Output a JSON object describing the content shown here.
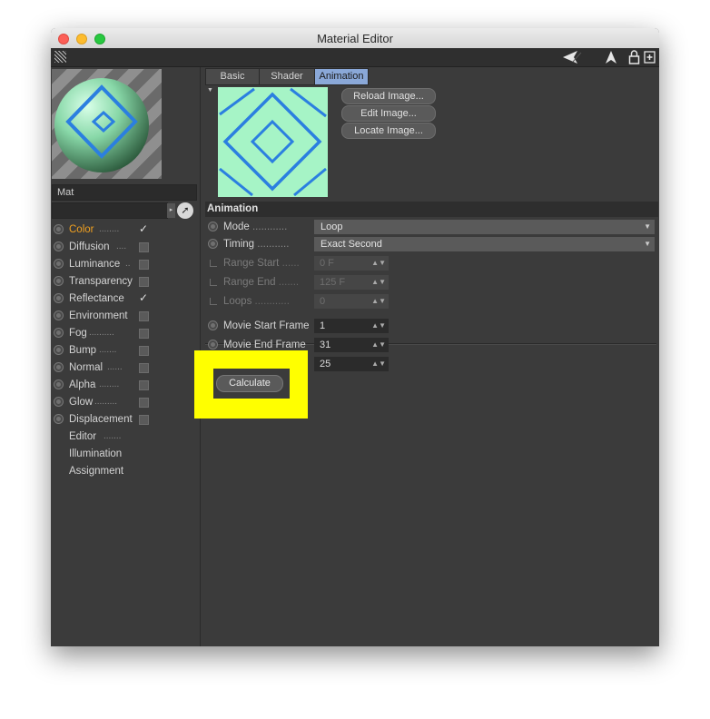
{
  "window": {
    "title": "Material Editor"
  },
  "material": {
    "name": "Mat"
  },
  "channels": [
    {
      "label": "Color",
      "dots": "........",
      "active": true,
      "checkbox": "checked"
    },
    {
      "label": "Diffusion",
      "dots": "....",
      "active": false,
      "checkbox": "unchecked"
    },
    {
      "label": "Luminance",
      "dots": "..",
      "active": false,
      "checkbox": "unchecked"
    },
    {
      "label": "Transparency",
      "dots": "",
      "active": false,
      "checkbox": "unchecked"
    },
    {
      "label": "Reflectance",
      "dots": "",
      "active": false,
      "checkbox": "checked"
    },
    {
      "label": "Environment",
      "dots": "",
      "active": false,
      "checkbox": "unchecked"
    },
    {
      "label": "Fog",
      "dots": "..........",
      "active": false,
      "checkbox": "unchecked"
    },
    {
      "label": "Bump",
      "dots": ".......",
      "active": false,
      "checkbox": "unchecked"
    },
    {
      "label": "Normal",
      "dots": "......",
      "active": false,
      "checkbox": "unchecked"
    },
    {
      "label": "Alpha",
      "dots": "........",
      "active": false,
      "checkbox": "unchecked"
    },
    {
      "label": "Glow",
      "dots": ".........",
      "active": false,
      "checkbox": "unchecked"
    },
    {
      "label": "Displacement",
      "dots": "",
      "active": false,
      "checkbox": "unchecked"
    }
  ],
  "extra_items": [
    {
      "label": "Editor",
      "dots": "......."
    },
    {
      "label": "Illumination",
      "dots": ""
    },
    {
      "label": "Assignment",
      "dots": ""
    }
  ],
  "tabs": [
    {
      "label": "Basic",
      "active": false
    },
    {
      "label": "Shader",
      "active": false
    },
    {
      "label": "Animation",
      "active": true
    }
  ],
  "image_buttons": {
    "reload": "Reload Image...",
    "edit": "Edit Image...",
    "locate": "Locate Image..."
  },
  "section": {
    "title": "Animation"
  },
  "params": {
    "mode": {
      "label": "Mode",
      "dots": "............",
      "value": "Loop"
    },
    "timing": {
      "label": "Timing",
      "dots": "...........",
      "value": "Exact Second"
    },
    "range_start": {
      "label": "Range Start",
      "dots": "......",
      "value": "0 F"
    },
    "range_end": {
      "label": "Range End",
      "dots": ".......",
      "value": "125 F"
    },
    "loops": {
      "label": "Loops",
      "dots": "............",
      "value": "0"
    },
    "movie_start": {
      "label": "Movie Start Frame",
      "value": "1"
    },
    "movie_end": {
      "label": "Movie End Frame",
      "value": "31"
    },
    "fps": {
      "value": "25"
    }
  },
  "calculate_button": "Calculate",
  "colors": {
    "accent": "#f0a020",
    "highlight": "#ffff00",
    "tab_active": "#8aa8d8",
    "texture_bg": "#a6f4c6",
    "texture_stroke": "#2b7fe0"
  }
}
